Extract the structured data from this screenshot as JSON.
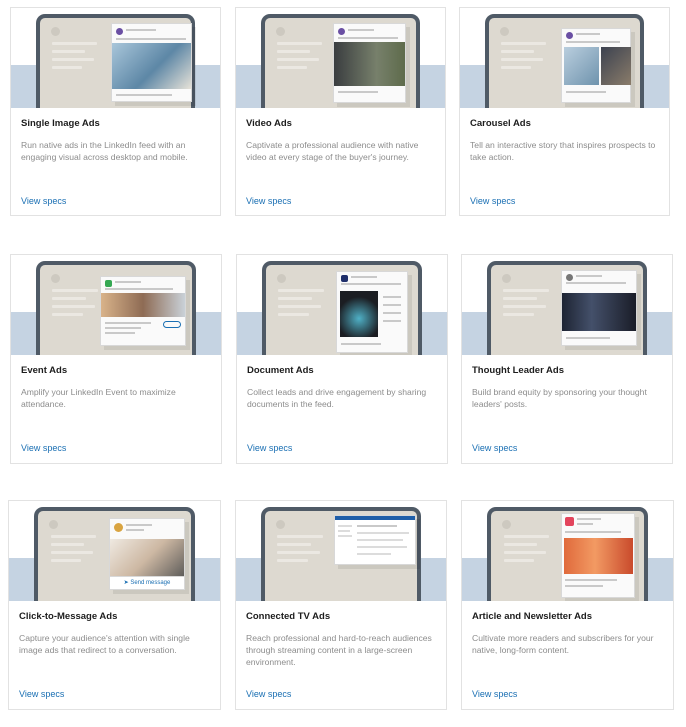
{
  "cards": [
    {
      "title": "Single Image Ads",
      "description": "Run native ads in the LinkedIn feed with an engaging visual across desktop and mobile.",
      "link": "View specs"
    },
    {
      "title": "Video Ads",
      "description": "Captivate a professional audience with native video at every stage of the buyer's journey.",
      "link": "View specs"
    },
    {
      "title": "Carousel Ads",
      "description": "Tell an interactive story that inspires prospects to take action.",
      "link": "View specs"
    },
    {
      "title": "Event Ads",
      "description": "Amplify your LinkedIn Event to maximize attendance.",
      "link": "View specs"
    },
    {
      "title": "Document Ads",
      "description": "Collect leads and drive engagement by sharing documents in the feed.",
      "link": "View specs"
    },
    {
      "title": "Thought Leader Ads",
      "description": "Build brand equity by sponsoring your thought leaders' posts.",
      "link": "View specs"
    },
    {
      "title": "Click-to-Message Ads",
      "description": "Capture your audience's attention with single image ads that redirect to a conversation.",
      "link": "View specs",
      "button_label": "Send message"
    },
    {
      "title": "Connected TV Ads",
      "description": "Reach professional and hard-to-reach audiences through streaming content in a large-screen environment.",
      "link": "View specs"
    },
    {
      "title": "Article and Newsletter Ads",
      "description": "Cultivate more readers and subscribers for your native, long-form content.",
      "link": "View specs"
    }
  ],
  "colors": {
    "link": "#1a6fb3",
    "band": "#c5d3e2",
    "monitor_frame": "#4f5a66",
    "monitor_screen": "#ddd9d0"
  }
}
